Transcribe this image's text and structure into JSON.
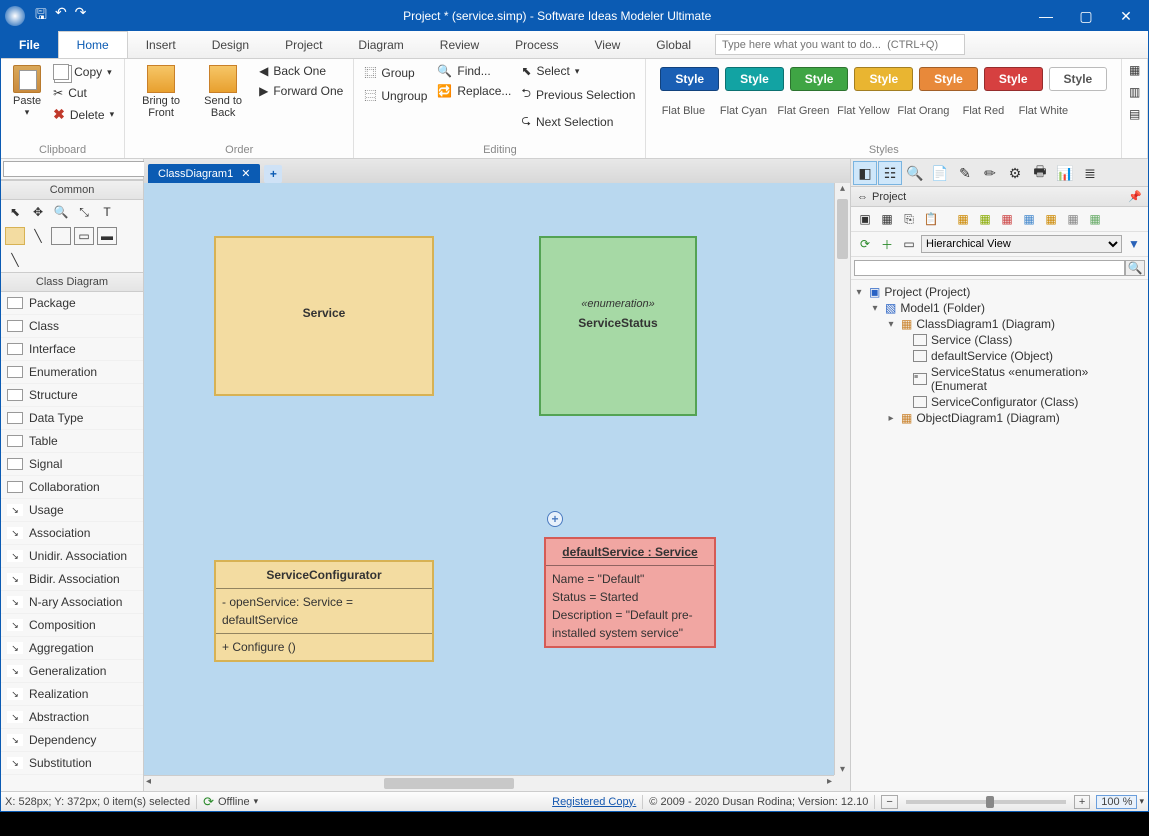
{
  "titlebar": {
    "title": "Project *  (service.simp)  -  Software Ideas Modeler Ultimate"
  },
  "menu": {
    "file": "File",
    "tabs": [
      "Home",
      "Insert",
      "Design",
      "Project",
      "Diagram",
      "Review",
      "Process",
      "View",
      "Global"
    ],
    "search_placeholder": "Type here what you want to do...  (CTRL+Q)"
  },
  "ribbon": {
    "clipboard": {
      "label": "Clipboard",
      "paste": "Paste",
      "copy": "Copy",
      "cut": "Cut",
      "delete": "Delete"
    },
    "order": {
      "label": "Order",
      "bring": "Bring to Front",
      "send": "Send to Back",
      "back_one": "Back One",
      "forward_one": "Forward One"
    },
    "editing": {
      "label": "Editing",
      "group": "Group",
      "ungroup": "Ungroup",
      "find": "Find...",
      "replace": "Replace...",
      "select": "Select",
      "prev_sel": "Previous Selection",
      "next_sel": "Next Selection"
    },
    "styles": {
      "label": "Styles",
      "btn": "Style",
      "names": [
        "Flat Blue",
        "Flat Cyan",
        "Flat Green",
        "Flat Yellow",
        "Flat Orang",
        "Flat Red",
        "Flat White"
      ],
      "colors": [
        "#1a5fb4",
        "#12a3a3",
        "#3fa544",
        "#e9b531",
        "#e8893a",
        "#d64040",
        "#ffffff"
      ]
    }
  },
  "left": {
    "common": "Common",
    "class_diagram": "Class Diagram",
    "items": [
      "Package",
      "Class",
      "Interface",
      "Enumeration",
      "Structure",
      "Data Type",
      "Table",
      "Signal",
      "Collaboration",
      "Usage",
      "Association",
      "Unidir. Association",
      "Bidir. Association",
      "N-ary Association",
      "Composition",
      "Aggregation",
      "Generalization",
      "Realization",
      "Abstraction",
      "Dependency",
      "Substitution"
    ]
  },
  "doc": {
    "tab": "ClassDiagram1"
  },
  "diagram": {
    "service": {
      "title": "Service"
    },
    "status": {
      "stereo": "«enumeration»",
      "title": "ServiceStatus"
    },
    "config": {
      "title": "ServiceConfigurator",
      "a1": "- openService: Service = defaultService",
      "m1": "+ Configure ()"
    },
    "default": {
      "title": "defaultService : Service",
      "l1": "Name = \"Default\"",
      "l2": "Status = Started",
      "l3": "Description = \"Default pre-installed system service\""
    }
  },
  "right": {
    "panel_title": "Project",
    "view_mode": "Hierarchical View",
    "tree": {
      "root": "Project (Project)",
      "model": "Model1 (Folder)",
      "cd": "ClassDiagram1 (Diagram)",
      "n1": "Service (Class)",
      "n2": "defaultService (Object)",
      "n3": "ServiceStatus «enumeration» (Enumerat",
      "n4": "ServiceConfigurator (Class)",
      "od": "ObjectDiagram1 (Diagram)"
    }
  },
  "status": {
    "pos": "X: 528px; Y: 372px; 0 item(s) selected",
    "offline": "Offline",
    "reg": "Registered Copy.",
    "copy": "© 2009 - 2020 Dusan Rodina; Version: 12.10",
    "zoom": "100 %"
  }
}
